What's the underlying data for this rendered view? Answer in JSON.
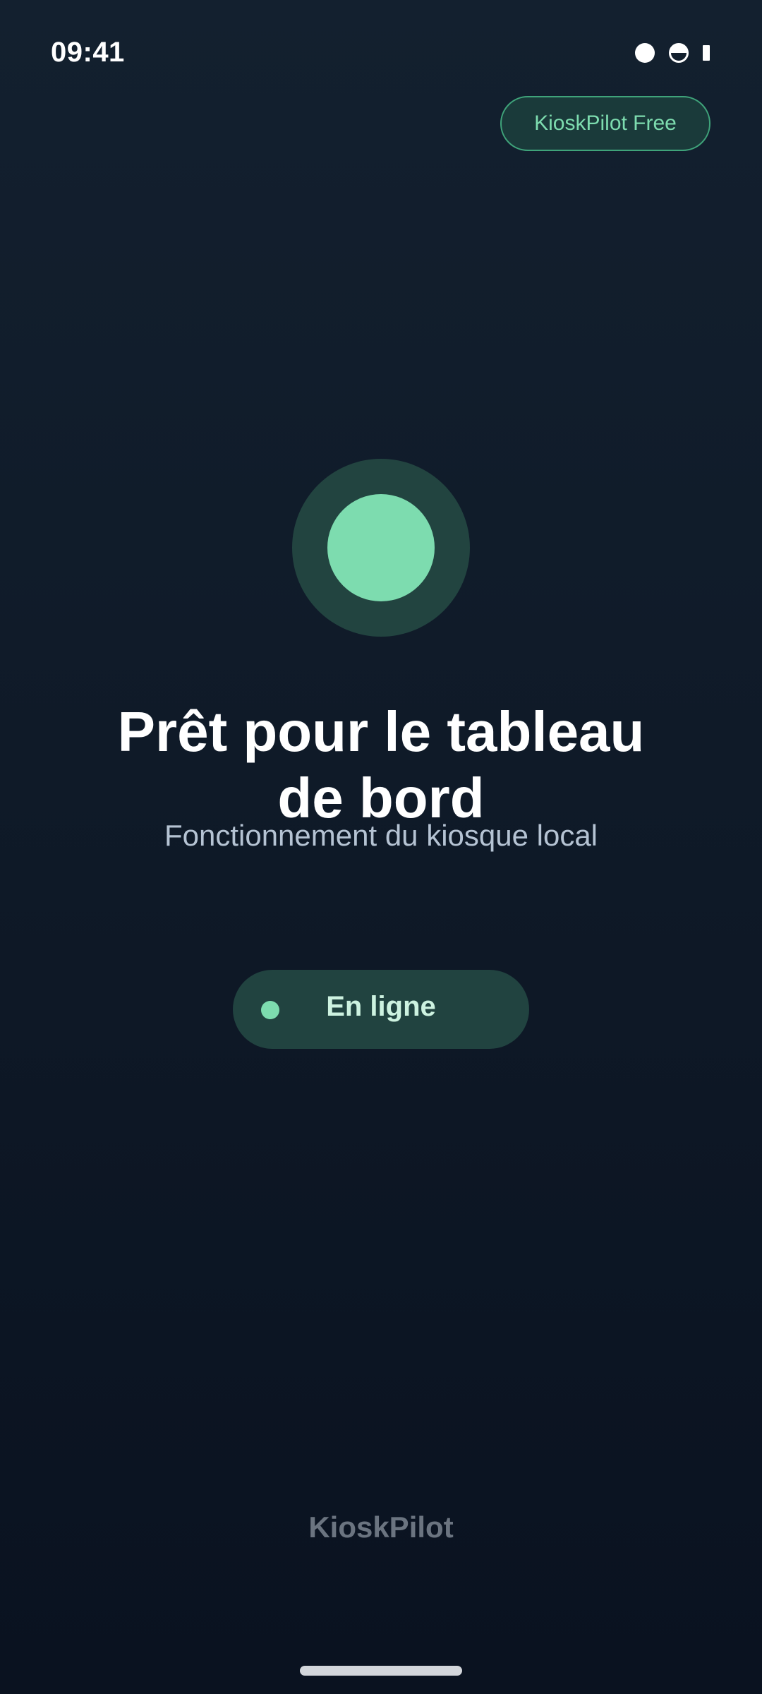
{
  "status_bar": {
    "time": "09:41"
  },
  "plan_badge": {
    "label": "KioskPilot Free"
  },
  "hero": {
    "title": "Prêt pour le tableau de bord",
    "subtitle": "Fonctionnement du kiosque local"
  },
  "connection": {
    "label": "En ligne"
  },
  "footer": {
    "brand": "KioskPilot"
  },
  "colors": {
    "accent": "#7ddcaf",
    "accent_dark": "#224440",
    "background_top": "#13202f",
    "background_bottom": "#0a1220",
    "subtitle_text": "#b5c3d3",
    "brand_text": "#6b7480"
  }
}
